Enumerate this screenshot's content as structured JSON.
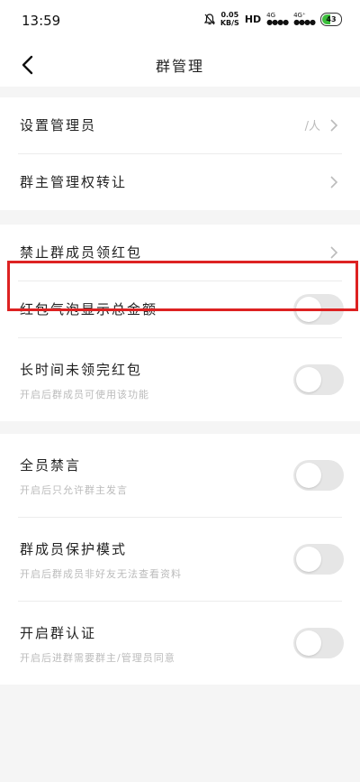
{
  "status": {
    "time": "13:59",
    "speed_value": "0.05",
    "speed_unit": "KB/S",
    "hd": "HD",
    "sig1": "4G",
    "sig2": "4G⁺",
    "battery": "43"
  },
  "nav": {
    "title": "群管理"
  },
  "group1": {
    "set_admin": {
      "label": "设置管理员",
      "value": "/人"
    },
    "transfer": {
      "label": "群主管理权转让"
    }
  },
  "group2": {
    "forbid_red": {
      "label": "禁止群成员领红包"
    },
    "bubble_amount": {
      "label": "红包气泡显示总金额",
      "on": false
    },
    "long_time": {
      "label": "长时间未领完红包",
      "sub": "开启后群成员可使用该功能",
      "on": false
    }
  },
  "group3": {
    "mute_all": {
      "label": "全员禁言",
      "sub": "开启后只允许群主发言",
      "on": false
    },
    "protect": {
      "label": "群成员保护模式",
      "sub": "开启后群成员非好友无法查看资料",
      "on": false
    },
    "verify": {
      "label": "开启群认证",
      "sub": "开启后进群需要群主/管理员同意",
      "on": false
    }
  },
  "colors": {
    "highlight": "#dd2222",
    "toggle_off": "#e6e6e6"
  }
}
